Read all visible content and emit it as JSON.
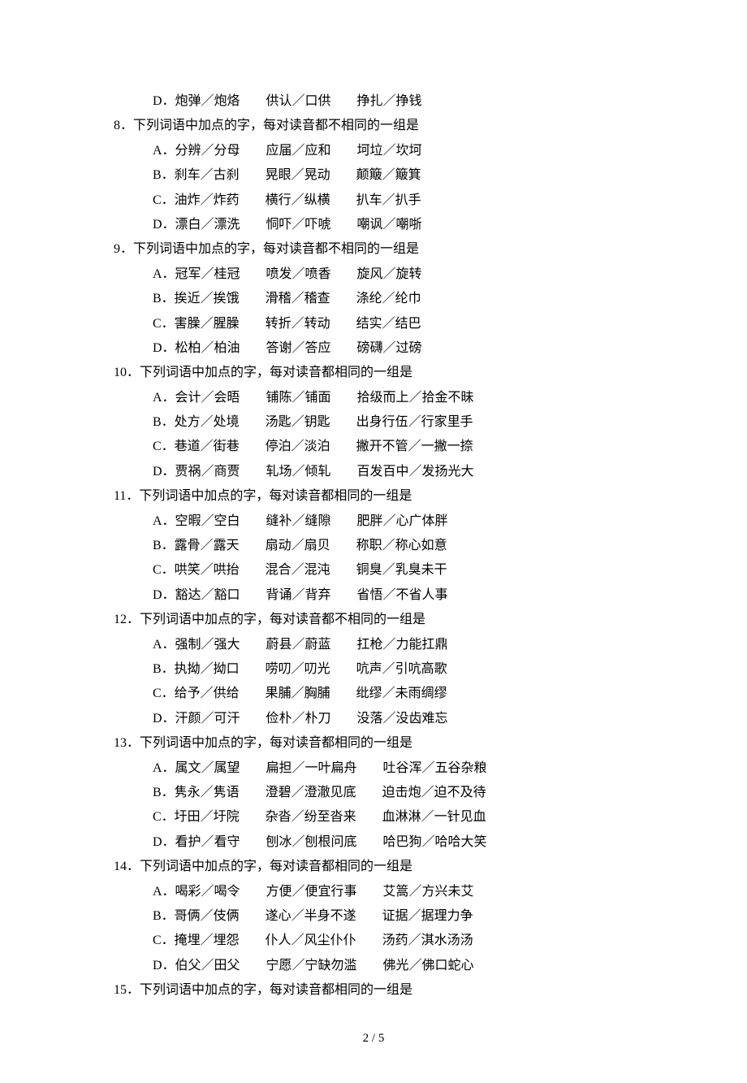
{
  "lines": [
    {
      "cls": "option",
      "text": "D．炮弹／炮烙　　供认／口供　　挣扎／挣钱"
    },
    {
      "cls": "question",
      "text": "8．下列词语中加点的字，每对读音都不相同的一组是"
    },
    {
      "cls": "option",
      "text": "A．分辨／分母　　应届／应和　　坷垃／坎坷"
    },
    {
      "cls": "option",
      "text": "B．刹车／古刹　　晃眼／晃动　　颠簸／簸箕"
    },
    {
      "cls": "option",
      "text": "C．油炸／炸药　　横行／纵横　　扒车／扒手"
    },
    {
      "cls": "option",
      "text": "D．漂白／漂洗　　恫吓／吓唬　　嘲讽／嘲哳"
    },
    {
      "cls": "question",
      "text": "9．下列词语中加点的字，每对读音都不相同的一组是"
    },
    {
      "cls": "option",
      "text": "A．冠军／桂冠　　喷发／喷香　　旋风／旋转"
    },
    {
      "cls": "option",
      "text": "B．挨近／挨饿　　滑稽／稽查　　涤纶／纶巾"
    },
    {
      "cls": "option",
      "text": "C．害臊／腥臊　　转折／转动　　结实／结巴"
    },
    {
      "cls": "option",
      "text": "D．松柏／柏油　　答谢／答应　　磅礴／过磅"
    },
    {
      "cls": "question",
      "text": "10．下列词语中加点的字，每对读音都相同的一组是"
    },
    {
      "cls": "option",
      "text": "A．会计／会晤　　铺陈／铺面　　拾级而上／拾金不昧"
    },
    {
      "cls": "option",
      "text": "B．处方／处境　　汤匙／钥匙　　出身行伍／行家里手"
    },
    {
      "cls": "option",
      "text": "C．巷道／街巷　　停泊／淡泊　　撇开不管／一撇一捺"
    },
    {
      "cls": "option",
      "text": "D．贾祸／商贾　　轧场／倾轧　　百发百中／发扬光大"
    },
    {
      "cls": "question",
      "text": "11．下列词语中加点的字，每对读音都相同的一组是"
    },
    {
      "cls": "option",
      "text": "A．空暇／空白　　缝补／缝隙　　肥胖／心广体胖"
    },
    {
      "cls": "option",
      "text": "B．露骨／露天　　扇动／扇贝　　称职／称心如意"
    },
    {
      "cls": "option",
      "text": "C．哄笑／哄抬　　混合／混沌　　铜臭／乳臭未干"
    },
    {
      "cls": "option",
      "text": "D．豁达／豁口　　背诵／背弃　　省悟／不省人事"
    },
    {
      "cls": "question",
      "text": "12．下列词语中加点的字，每对读音都不相同的一组是"
    },
    {
      "cls": "option",
      "text": "A．强制／强大　　蔚县／蔚蓝　　扛枪／力能扛鼎"
    },
    {
      "cls": "option",
      "text": "B．执拗／拗口　　唠叨／叨光　　吭声／引吭高歌"
    },
    {
      "cls": "option",
      "text": "C．给予／供给　　果脯／胸脯　　纰缪／未雨绸缪"
    },
    {
      "cls": "option",
      "text": "D．汗颜／可汗　　俭朴／朴刀　　没落／没齿难忘"
    },
    {
      "cls": "question",
      "text": "13．下列词语中加点的字，每对读音都相同的一组是"
    },
    {
      "cls": "option",
      "text": "A．属文／属望　　扁担／一叶扁舟　　吐谷浑／五谷杂粮"
    },
    {
      "cls": "option",
      "text": "B．隽永／隽语　　澄碧／澄澈见底　　迫击炮／迫不及待"
    },
    {
      "cls": "option",
      "text": "C．圩田／圩院　　杂沓／纷至沓来　　血淋淋／一针见血"
    },
    {
      "cls": "option",
      "text": "D．看护／看守　　刨冰／刨根问底　　哈巴狗／哈哈大笑"
    },
    {
      "cls": "question",
      "text": "14．下列词语中加点的字，每对读音都相同的一组是"
    },
    {
      "cls": "option",
      "text": "A．喝彩／喝令　　方便／便宜行事　　艾篙／方兴未艾"
    },
    {
      "cls": "option",
      "text": "B．哥俩／伎俩　　遂心／半身不遂　　证据／据理力争"
    },
    {
      "cls": "option",
      "text": "C．掩埋／埋怨　　仆人／风尘仆仆　　汤药／淇水汤汤"
    },
    {
      "cls": "option",
      "text": "D．伯父／田父　　宁愿／宁缺勿滥　　佛光／佛口蛇心"
    },
    {
      "cls": "question",
      "text": "15．下列词语中加点的字，每对读音都相同的一组是"
    }
  ],
  "pageNumber": "2 / 5"
}
